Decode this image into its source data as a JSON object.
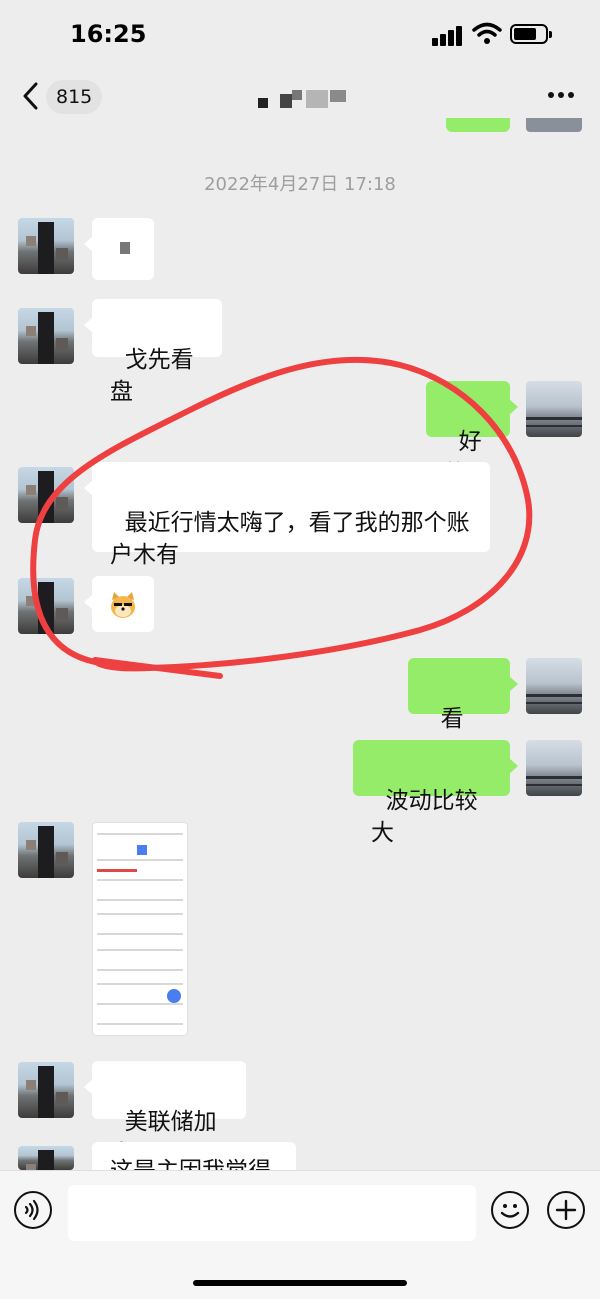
{
  "status_bar": {
    "time": "16:25"
  },
  "nav": {
    "back_count": "815"
  },
  "chat": {
    "timestamp": "2022年4月27日 17:18",
    "messages": [
      {
        "side": "in",
        "text": ""
      },
      {
        "side": "in",
        "text": "戈先看盘"
      },
      {
        "side": "out",
        "text": "好的"
      },
      {
        "side": "in",
        "text": "最近行情太嗨了，看了我的那个账\n户木有"
      },
      {
        "side": "in",
        "text": ""
      },
      {
        "side": "out",
        "text": "看了，"
      },
      {
        "side": "out",
        "text": "波动比较大"
      },
      {
        "side": "in",
        "text": ""
      },
      {
        "side": "in",
        "text": "美联储加息"
      },
      {
        "side": "in",
        "text": "这是主因我觉得"
      }
    ]
  },
  "colors": {
    "outgoing_bubble": "#95ec69",
    "incoming_bubble": "#ffffff",
    "background": "#ededed",
    "annotation": "#ee4040"
  },
  "icons": [
    "back-icon",
    "more-icon",
    "voice-icon",
    "emoji-icon",
    "plus-icon",
    "doge-sticker"
  ]
}
